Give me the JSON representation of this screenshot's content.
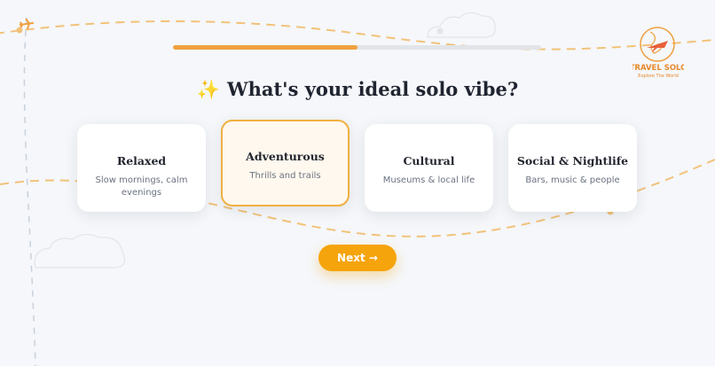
{
  "progress": {
    "value": 0.5
  },
  "brand": {
    "name": "TRAVEL SOLO",
    "tagline": "Explore The World"
  },
  "question": {
    "emoji": "✨",
    "text": "What's your ideal solo vibe?"
  },
  "options": [
    {
      "title": "Relaxed",
      "desc": "Slow mornings, calm evenings",
      "selected": false
    },
    {
      "title": "Adventurous",
      "desc": "Thrills and trails",
      "selected": true
    },
    {
      "title": "Cultural",
      "desc": "Museums & local life",
      "selected": false
    },
    {
      "title": "Social & Nightlife",
      "desc": "Bars, music & people",
      "selected": false
    }
  ],
  "next_button": {
    "label": "Next →"
  },
  "colors": {
    "accent": "#f5a40c",
    "progress": "#f0a040",
    "selected_border": "#f0b040"
  },
  "icons": {
    "airplane": "airplane-icon",
    "sparkle": "sparkles-emoji"
  }
}
